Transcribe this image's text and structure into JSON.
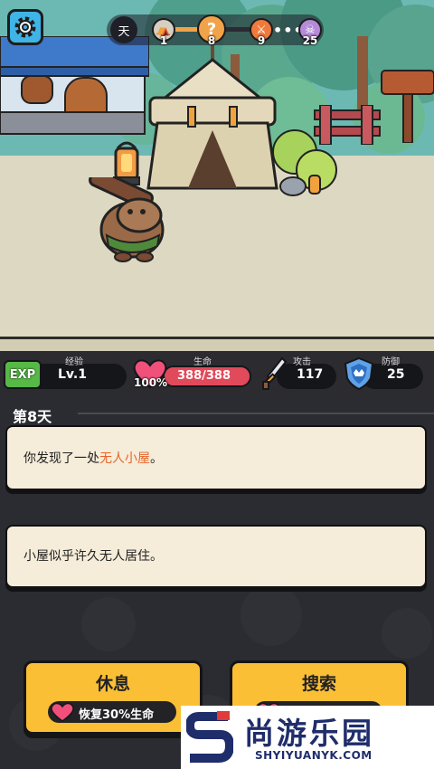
{
  "top_hud": {
    "day_chip": "天",
    "nodes": [
      {
        "icon": "camp-icon",
        "count": "1"
      },
      {
        "icon": "question-icon",
        "count": "8"
      },
      {
        "icon": "crossed-swords-icon",
        "count": "9"
      },
      {
        "icon": "skull-icon",
        "count": "25"
      }
    ],
    "ellipsis": "•••"
  },
  "stats": {
    "exp_badge": "EXP",
    "exp_label": "经验",
    "level": "Lv.1",
    "hp_label": "生命",
    "hp_percent": "100%",
    "hp_value": "388/388",
    "hp_fraction": 1.0,
    "attack_label": "攻击",
    "attack_value": "117",
    "defense_label": "防御",
    "defense_value": "25"
  },
  "log": {
    "day_title": "第8天",
    "entries": [
      {
        "prefix": "你发现了一处",
        "highlight": "无人小屋",
        "suffix": "。"
      },
      {
        "text": "小屋似乎许久无人居住。"
      }
    ]
  },
  "actions": {
    "rest": {
      "label": "休息",
      "sub": "恢复30%生命"
    },
    "search": {
      "label": "搜索"
    }
  },
  "watermark": {
    "title": "尚游乐园",
    "url": "SHYIYUANYK.COM"
  },
  "colors": {
    "accent": "#fbbf35",
    "hp": "#e04a5a",
    "highlight": "#e5652c",
    "settings": "#3fb4e6"
  }
}
